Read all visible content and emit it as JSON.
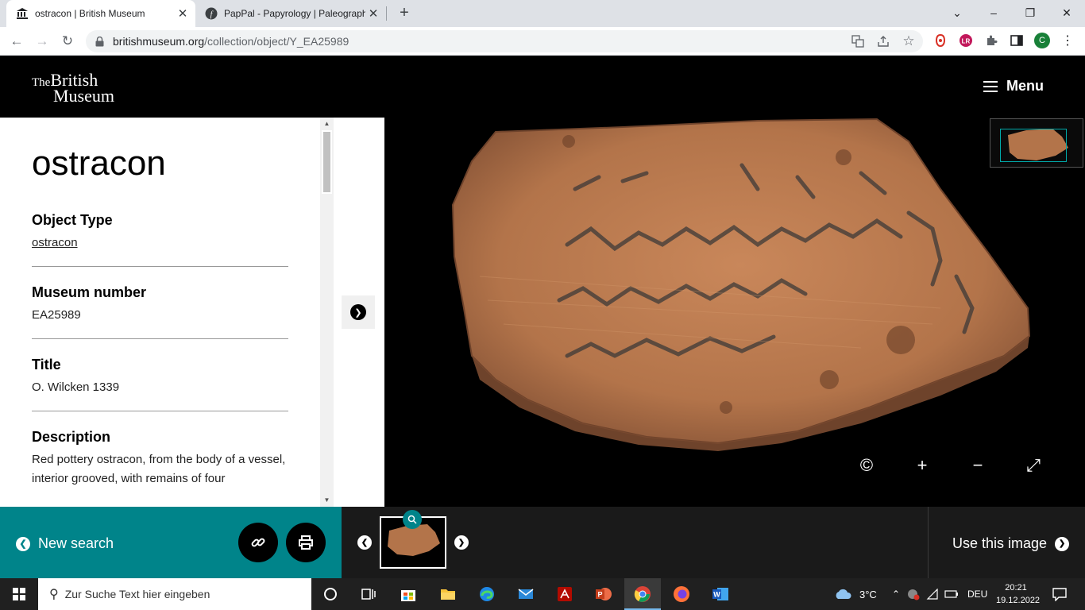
{
  "browser": {
    "tabs": [
      {
        "title": "ostracon | British Museum",
        "close": "✕"
      },
      {
        "title": "PapPal - Papyrology | Paleograph",
        "close": "✕"
      }
    ],
    "new_tab": "+",
    "window_controls": {
      "minimize": "⌄",
      "restore": "–",
      "maximize": "❐",
      "close": "✕"
    },
    "nav": {
      "back": "←",
      "forward": "→",
      "reload": "↻"
    },
    "url_host": "britishmuseum.org",
    "url_path": "/collection/object/Y_EA25989",
    "profile_initial": "C"
  },
  "site": {
    "logo_the": "The",
    "logo_british": "British",
    "logo_museum": "Museum",
    "menu_label": "Menu"
  },
  "object": {
    "title": "ostracon",
    "fields": [
      {
        "label": "Object Type",
        "value": "ostracon",
        "is_link": true
      },
      {
        "label": "Museum number",
        "value": "EA25989",
        "is_link": false
      },
      {
        "label": "Title",
        "value": "O. Wilcken 1339",
        "is_link": false
      },
      {
        "label": "Description",
        "value": "Red pottery ostracon, from the body of a vessel, interior grooved, with remains of four",
        "is_link": false
      }
    ]
  },
  "viewer": {
    "controls": {
      "copyright": "©",
      "zoom_in": "+",
      "zoom_out": "−",
      "fullscreen": "⤢"
    }
  },
  "bottom": {
    "new_search": "New search",
    "use_image": "Use this image"
  },
  "taskbar": {
    "search_placeholder": "Zur Suche Text hier eingeben",
    "weather": "3°C",
    "language": "DEU",
    "time": "20:21",
    "date": "19.12.2022"
  },
  "colors": {
    "teal": "#00848a",
    "sherd": "#b97a4e"
  }
}
